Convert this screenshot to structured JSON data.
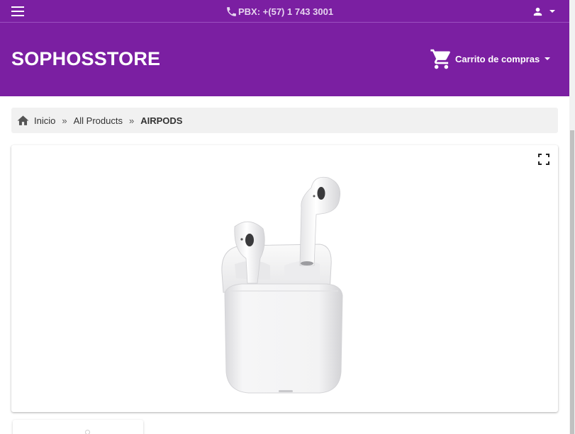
{
  "topbar": {
    "phone_text": "PBX: +(57) 1 743 3001",
    "icons": [
      "menu-icon",
      "phone-icon",
      "person-icon",
      "caret-down-icon"
    ]
  },
  "header": {
    "brand": "SOPHOSSTORE",
    "cart_label": "Carrito de compras",
    "cart_icon": "shopping-cart-icon",
    "background": "#7b1fa2"
  },
  "breadcrumb": {
    "home_label": "Inicio",
    "separator": "»",
    "category": "All Products",
    "current": "AIRPODS",
    "home_icon": "home-icon"
  },
  "product": {
    "image_subject": "airpods-with-charging-case",
    "fullscreen_icon": "fullscreen-icon"
  }
}
